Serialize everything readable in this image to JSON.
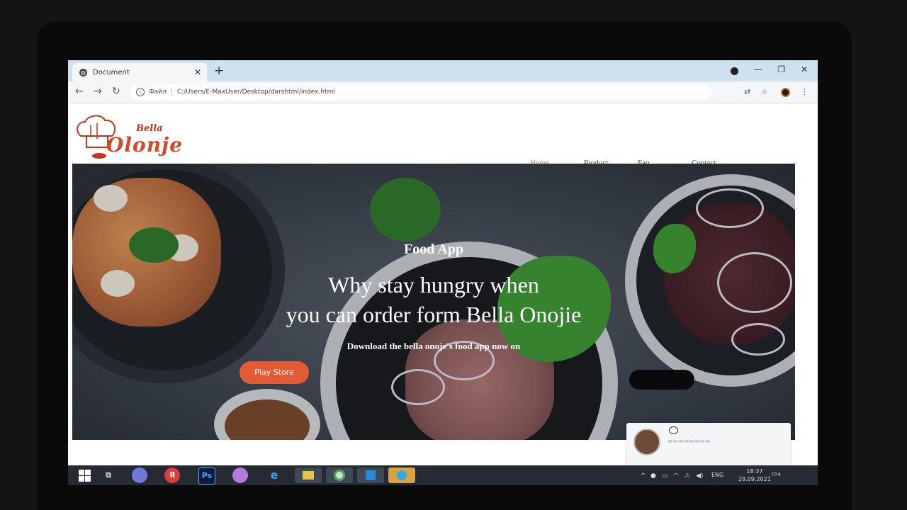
{
  "browser": {
    "tab": {
      "title": "Document"
    },
    "new_tab_label": "+",
    "omnibox": {
      "scheme": "Файл",
      "url": "C:/Users/E-MaxUser/Desktop/darshtml/index.html"
    }
  },
  "site": {
    "logo": {
      "small": "Bella",
      "big": "Olonje"
    },
    "nav": [
      {
        "label": "Home",
        "active": true
      },
      {
        "label": "Product",
        "active": false
      },
      {
        "label": "Faq",
        "active": false
      },
      {
        "label": "Contact",
        "active": false
      }
    ],
    "hero": {
      "kicker": "Food App",
      "title_line1": "Why stay hungry when",
      "title_line2": "you can order form Bella Onojie",
      "subtitle": "Download the bella onoje's food app now on",
      "play_store_button": "Play Store"
    }
  },
  "taskbar": {
    "pinned": [
      "windows-start",
      "task-view",
      "alice-assistant",
      "yandex-browser",
      "photoshop",
      "paint-3d",
      "edge",
      "file-explorer",
      "chrome",
      "vscode",
      "telegram"
    ],
    "lang": "ENG",
    "time": "18:37",
    "date": "29.09.2021",
    "notifications": "4"
  },
  "colors": {
    "brand_red": "#d04a2a",
    "button_orange": "#e35b36",
    "nav_active": "#d07a5a"
  }
}
